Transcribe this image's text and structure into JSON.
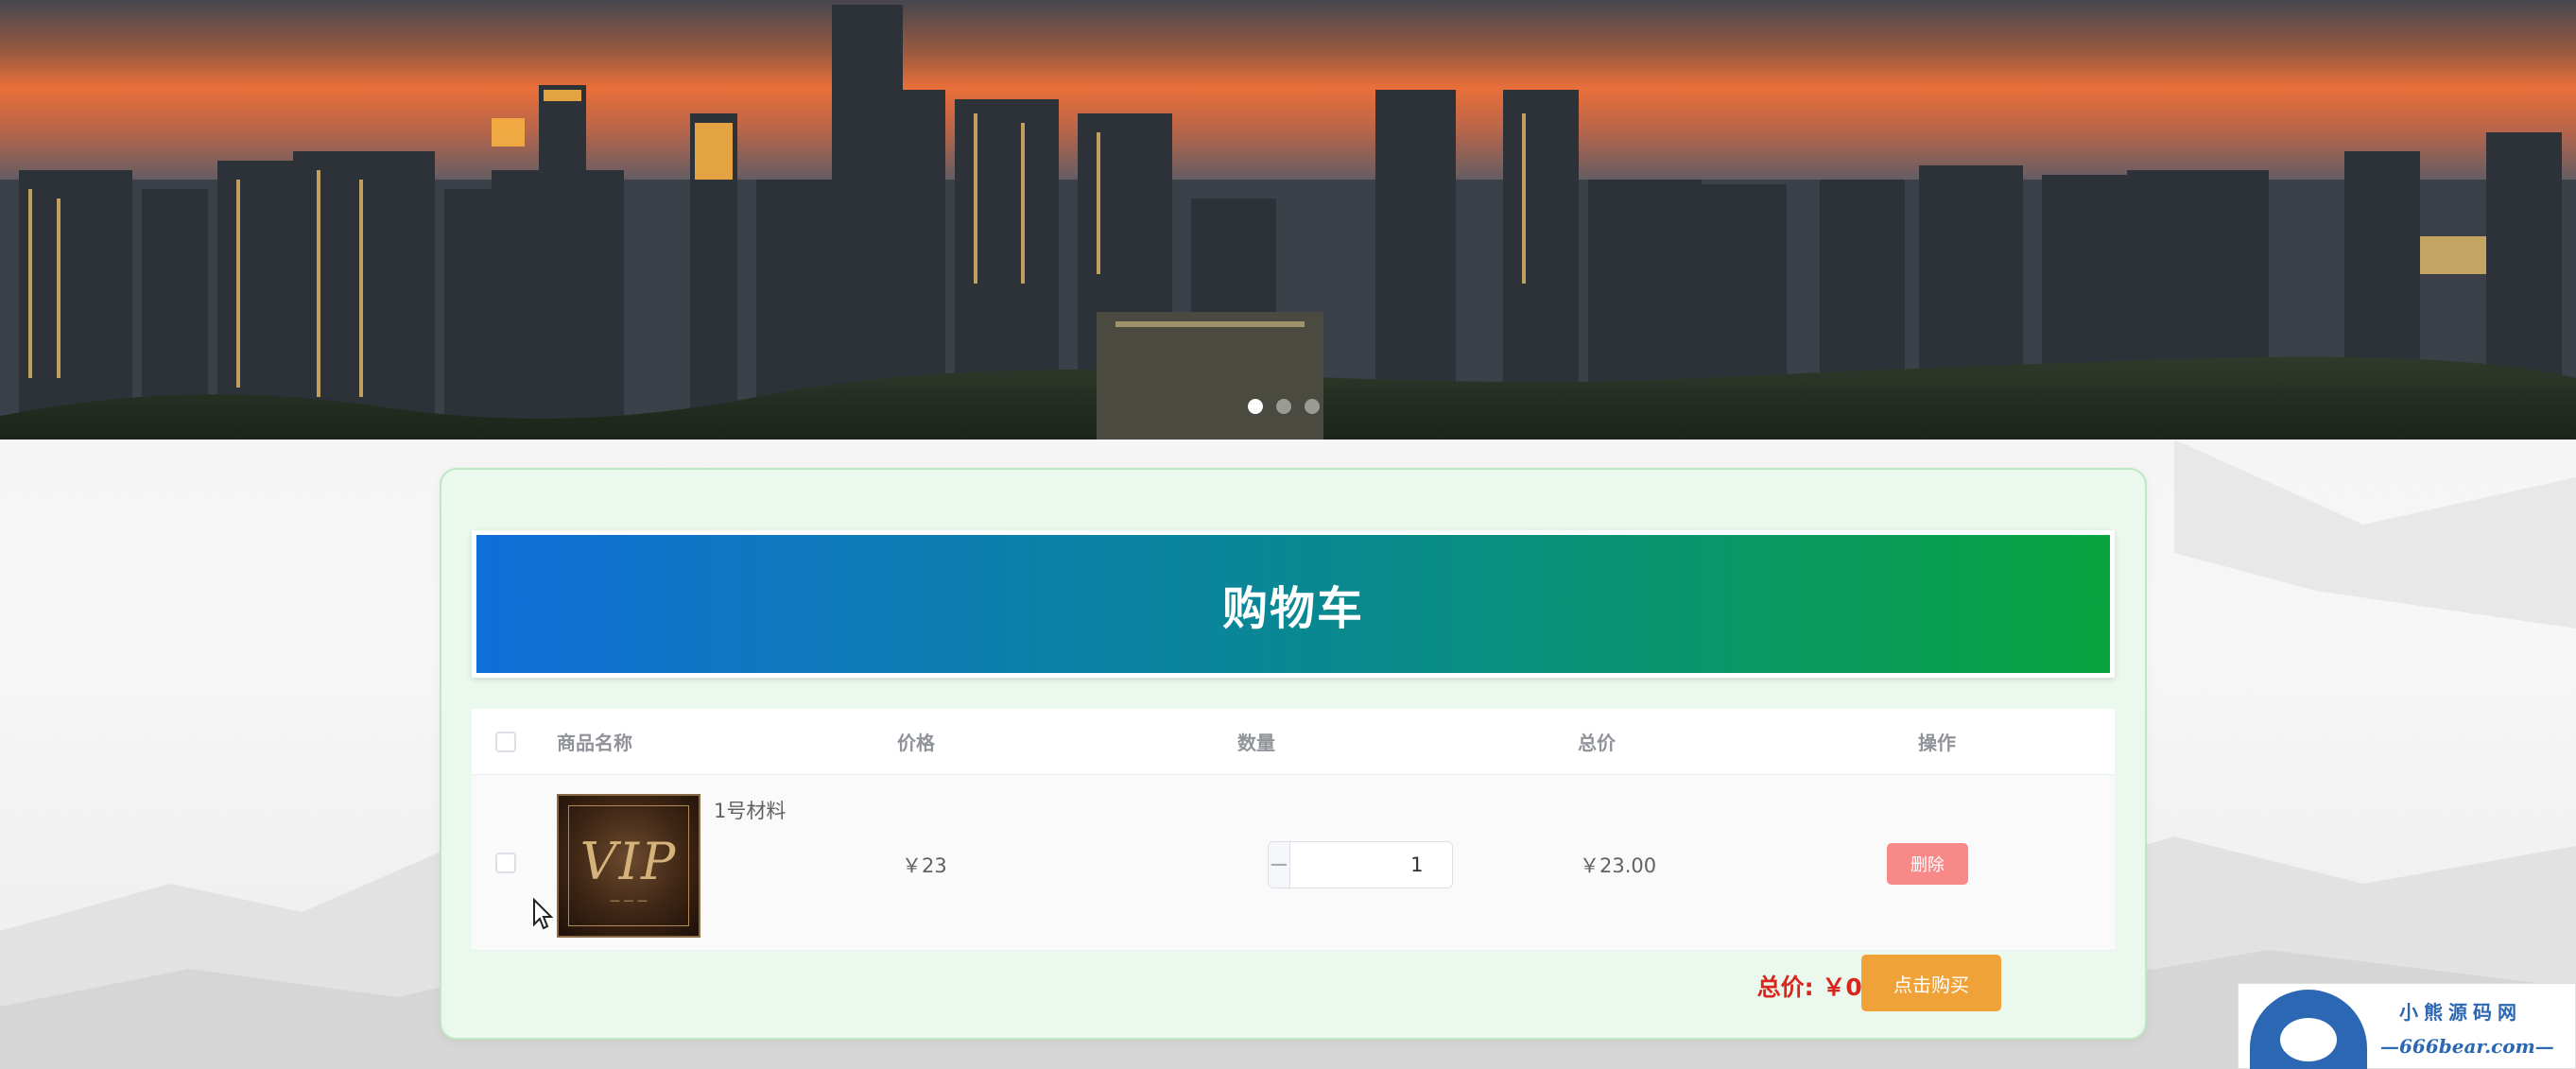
{
  "banner": {
    "slides": 3,
    "active_slide": 1
  },
  "cart": {
    "title": "购物车",
    "headers": {
      "name": "商品名称",
      "price": "价格",
      "quantity": "数量",
      "subtotal": "总价",
      "action": "操作"
    },
    "items": [
      {
        "name": "1号材料",
        "price": "￥23",
        "quantity": "1",
        "subtotal": "￥23.00",
        "delete_label": "删除",
        "thumbnail_icon": "vip-card-image"
      }
    ],
    "stepper": {
      "minus": "−",
      "plus": "+"
    },
    "total_label": "总价:",
    "total_value": "￥0.00",
    "buy_label": "点击购买"
  },
  "watermark": {
    "line1": "小熊源码网",
    "line2": "—666bear.com—"
  },
  "colors": {
    "header_gradient_start": "#0f6ed8",
    "header_gradient_end": "#08a43f",
    "delete_button": "#f78989",
    "buy_button": "#eea237",
    "total_text": "#d9261c",
    "card_bg": "#eaf8ee"
  }
}
